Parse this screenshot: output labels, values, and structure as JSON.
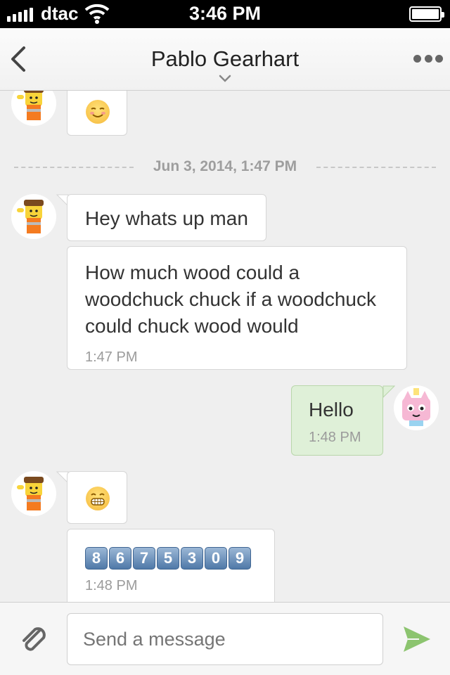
{
  "status_bar": {
    "carrier": "dtac",
    "time": "3:46 PM"
  },
  "header": {
    "title": "Pablo Gearhart"
  },
  "chat": {
    "date_separator": "Jun 3, 2014, 1:47 PM",
    "messages": [
      {
        "direction": "in",
        "text": "Hey whats up man"
      },
      {
        "direction": "in",
        "lines": [
          "How much wood could a",
          "woodchuck chuck if a woodchuck",
          "could chuck wood would"
        ],
        "time": "1:47 PM"
      },
      {
        "direction": "out",
        "text": "Hello",
        "time": "1:48 PM"
      },
      {
        "direction": "in",
        "keycaps": [
          "8",
          "6",
          "7",
          "5",
          "3",
          "0",
          "9"
        ],
        "time": "1:48 PM"
      }
    ]
  },
  "composer": {
    "placeholder": "Send a message"
  },
  "colors": {
    "outgoing_bubble": "#dff0d8",
    "send_icon": "#8cc46f",
    "keycap": "#4f79a8"
  }
}
